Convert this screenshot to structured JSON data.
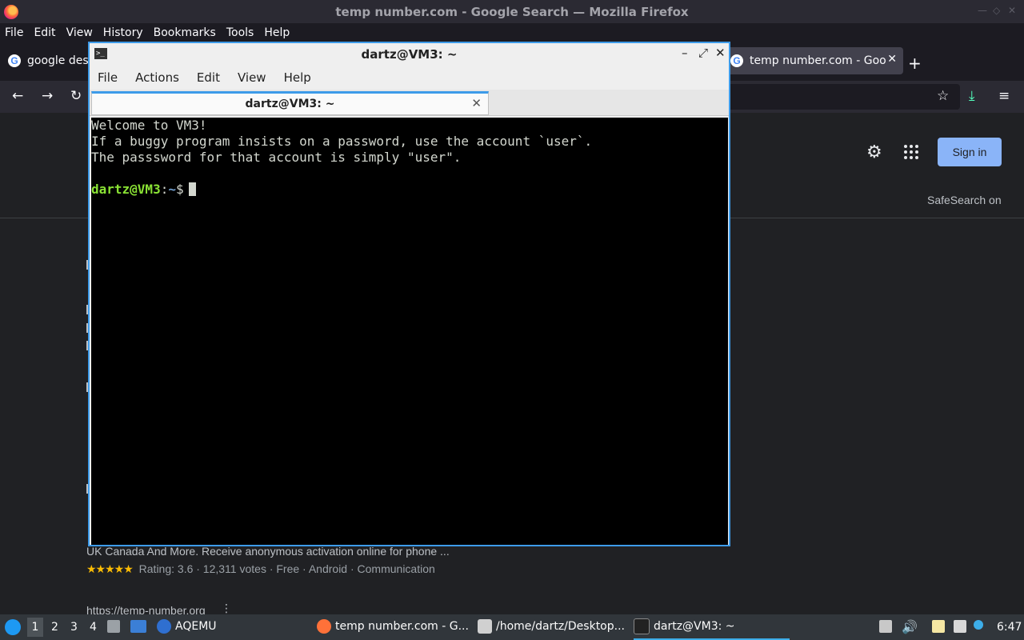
{
  "firefox": {
    "window_title": "temp number.com - Google Search — Mozilla Firefox",
    "menu": [
      "File",
      "Edit",
      "View",
      "History",
      "Bookmarks",
      "Tools",
      "Help"
    ],
    "tabs": [
      {
        "label": "google desk"
      },
      {
        "label": "temp number.com - Goo"
      }
    ]
  },
  "google": {
    "sign_in": "Sign in",
    "safesearch": "SafeSearch on",
    "snippet": "UK Canada And More. Receive anonymous activation online for phone ...",
    "stars": "★★★★★",
    "rating_text": "Rating: 3.6 · 12,311 votes · Free · Android · Communication",
    "result_url": "https://temp-number.org"
  },
  "terminal": {
    "window_title": "dartz@VM3: ~",
    "menu": [
      "File",
      "Actions",
      "Edit",
      "View",
      "Help"
    ],
    "tab_label": "dartz@VM3: ~",
    "lines": [
      "Welcome to VM3!",
      "If a buggy program insists on a password, use the account `user`.",
      "The passsword for that account is simply \"user\"."
    ],
    "prompt_user": "dartz@VM3",
    "prompt_sep": ":",
    "prompt_path": "~",
    "prompt_char": "$"
  },
  "taskbar": {
    "workspaces": [
      "1",
      "2",
      "3",
      "4"
    ],
    "tasks": [
      {
        "label": "AQEMU"
      },
      {
        "label": "temp number.com - G..."
      },
      {
        "label": "/home/dartz/Desktop..."
      },
      {
        "label": "dartz@VM3: ~"
      }
    ],
    "clock": "6:47"
  },
  "colors": {
    "accent": "#3d9be9",
    "prompt_user": "#8ae234",
    "prompt_path": "#729fcf",
    "signin_bg": "#8ab4f8"
  }
}
